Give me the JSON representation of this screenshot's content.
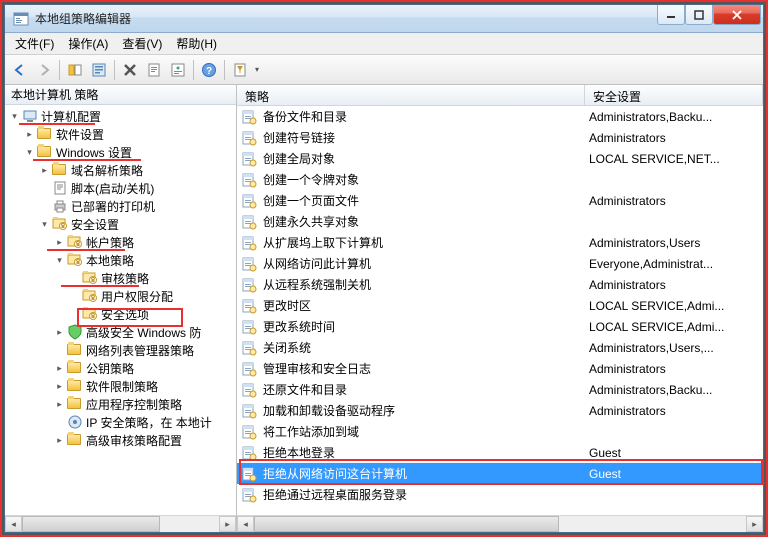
{
  "window": {
    "title": "本地组策略编辑器"
  },
  "menu": {
    "file": "文件(F)",
    "action": "操作(A)",
    "view": "查看(V)",
    "help": "帮助(H)"
  },
  "tree": {
    "header": "本地计算机 策略",
    "n0": "计算机配置",
    "n1": "软件设置",
    "n2": "Windows 设置",
    "n3": "域名解析策略",
    "n4": "脚本(启动/关机)",
    "n5": "已部署的打印机",
    "n6": "安全设置",
    "n7": "帐户策略",
    "n8": "本地策略",
    "n9": "审核策略",
    "n10": "用户权限分配",
    "n11": "安全选项",
    "n12": "高级安全 Windows 防",
    "n13": "网络列表管理器策略",
    "n14": "公钥策略",
    "n15": "软件限制策略",
    "n16": "应用程序控制策略",
    "n17": "IP 安全策略，在 本地计",
    "n18": "高级审核策略配置"
  },
  "list": {
    "col1": "策略",
    "col2": "安全设置",
    "rows": [
      {
        "name": "备份文件和目录",
        "val": "Administrators,Backu..."
      },
      {
        "name": "创建符号链接",
        "val": "Administrators"
      },
      {
        "name": "创建全局对象",
        "val": "LOCAL SERVICE,NET..."
      },
      {
        "name": "创建一个令牌对象",
        "val": ""
      },
      {
        "name": "创建一个页面文件",
        "val": "Administrators"
      },
      {
        "name": "创建永久共享对象",
        "val": ""
      },
      {
        "name": "从扩展坞上取下计算机",
        "val": "Administrators,Users"
      },
      {
        "name": "从网络访问此计算机",
        "val": "Everyone,Administrat..."
      },
      {
        "name": "从远程系统强制关机",
        "val": "Administrators"
      },
      {
        "name": "更改时区",
        "val": "LOCAL SERVICE,Admi..."
      },
      {
        "name": "更改系统时间",
        "val": "LOCAL SERVICE,Admi..."
      },
      {
        "name": "关闭系统",
        "val": "Administrators,Users,..."
      },
      {
        "name": "管理审核和安全日志",
        "val": "Administrators"
      },
      {
        "name": "还原文件和目录",
        "val": "Administrators,Backu..."
      },
      {
        "name": "加载和卸载设备驱动程序",
        "val": "Administrators"
      },
      {
        "name": "将工作站添加到域",
        "val": ""
      },
      {
        "name": "拒绝本地登录",
        "val": "Guest"
      },
      {
        "name": "拒绝从网络访问这台计算机",
        "val": "Guest",
        "selected": true
      },
      {
        "name": "拒绝通过远程桌面服务登录",
        "val": ""
      }
    ]
  }
}
